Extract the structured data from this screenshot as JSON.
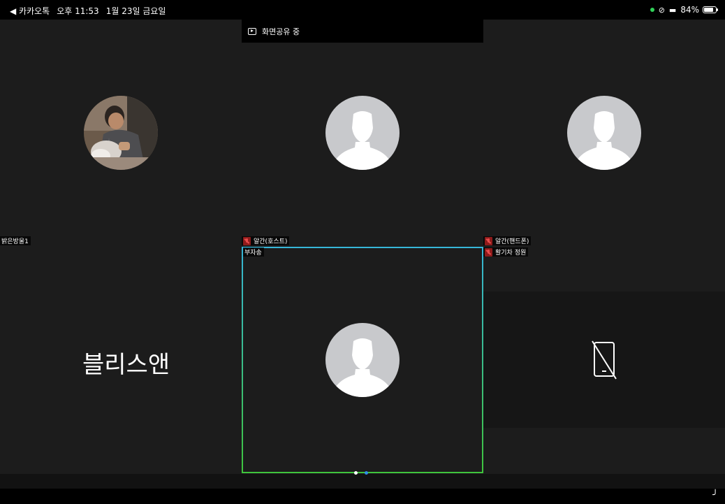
{
  "status_bar": {
    "back_app": "◀ 카카오톡",
    "time": "오후 11:53",
    "date": "1월 23일 금요일",
    "battery": "84%",
    "battery_level": 0.84
  },
  "share_banner": {
    "label": "화면공유 중"
  },
  "participants": [
    {
      "name": "밝은방울1",
      "muted": true
    },
    {
      "name": "알간(호스트)",
      "muted": true
    },
    {
      "name": "알간(핸드폰)",
      "muted": true
    },
    {
      "name": "블리스앤"
    },
    {
      "name": "부자송",
      "active_speaker": true
    },
    {
      "name": "활기차 정원",
      "muted": true
    }
  ],
  "colors": {
    "stage_bg": "#1c1c1c",
    "avatar_default": "#c8c9cc",
    "active_border_top": "#36b6d8",
    "active_border_bottom": "#3fc43c",
    "dot_current": "#ffffff",
    "dot_other": "#2f8de4",
    "muted_red": "#e84b4b"
  },
  "pagination": {
    "pages": 2,
    "current": 1
  }
}
